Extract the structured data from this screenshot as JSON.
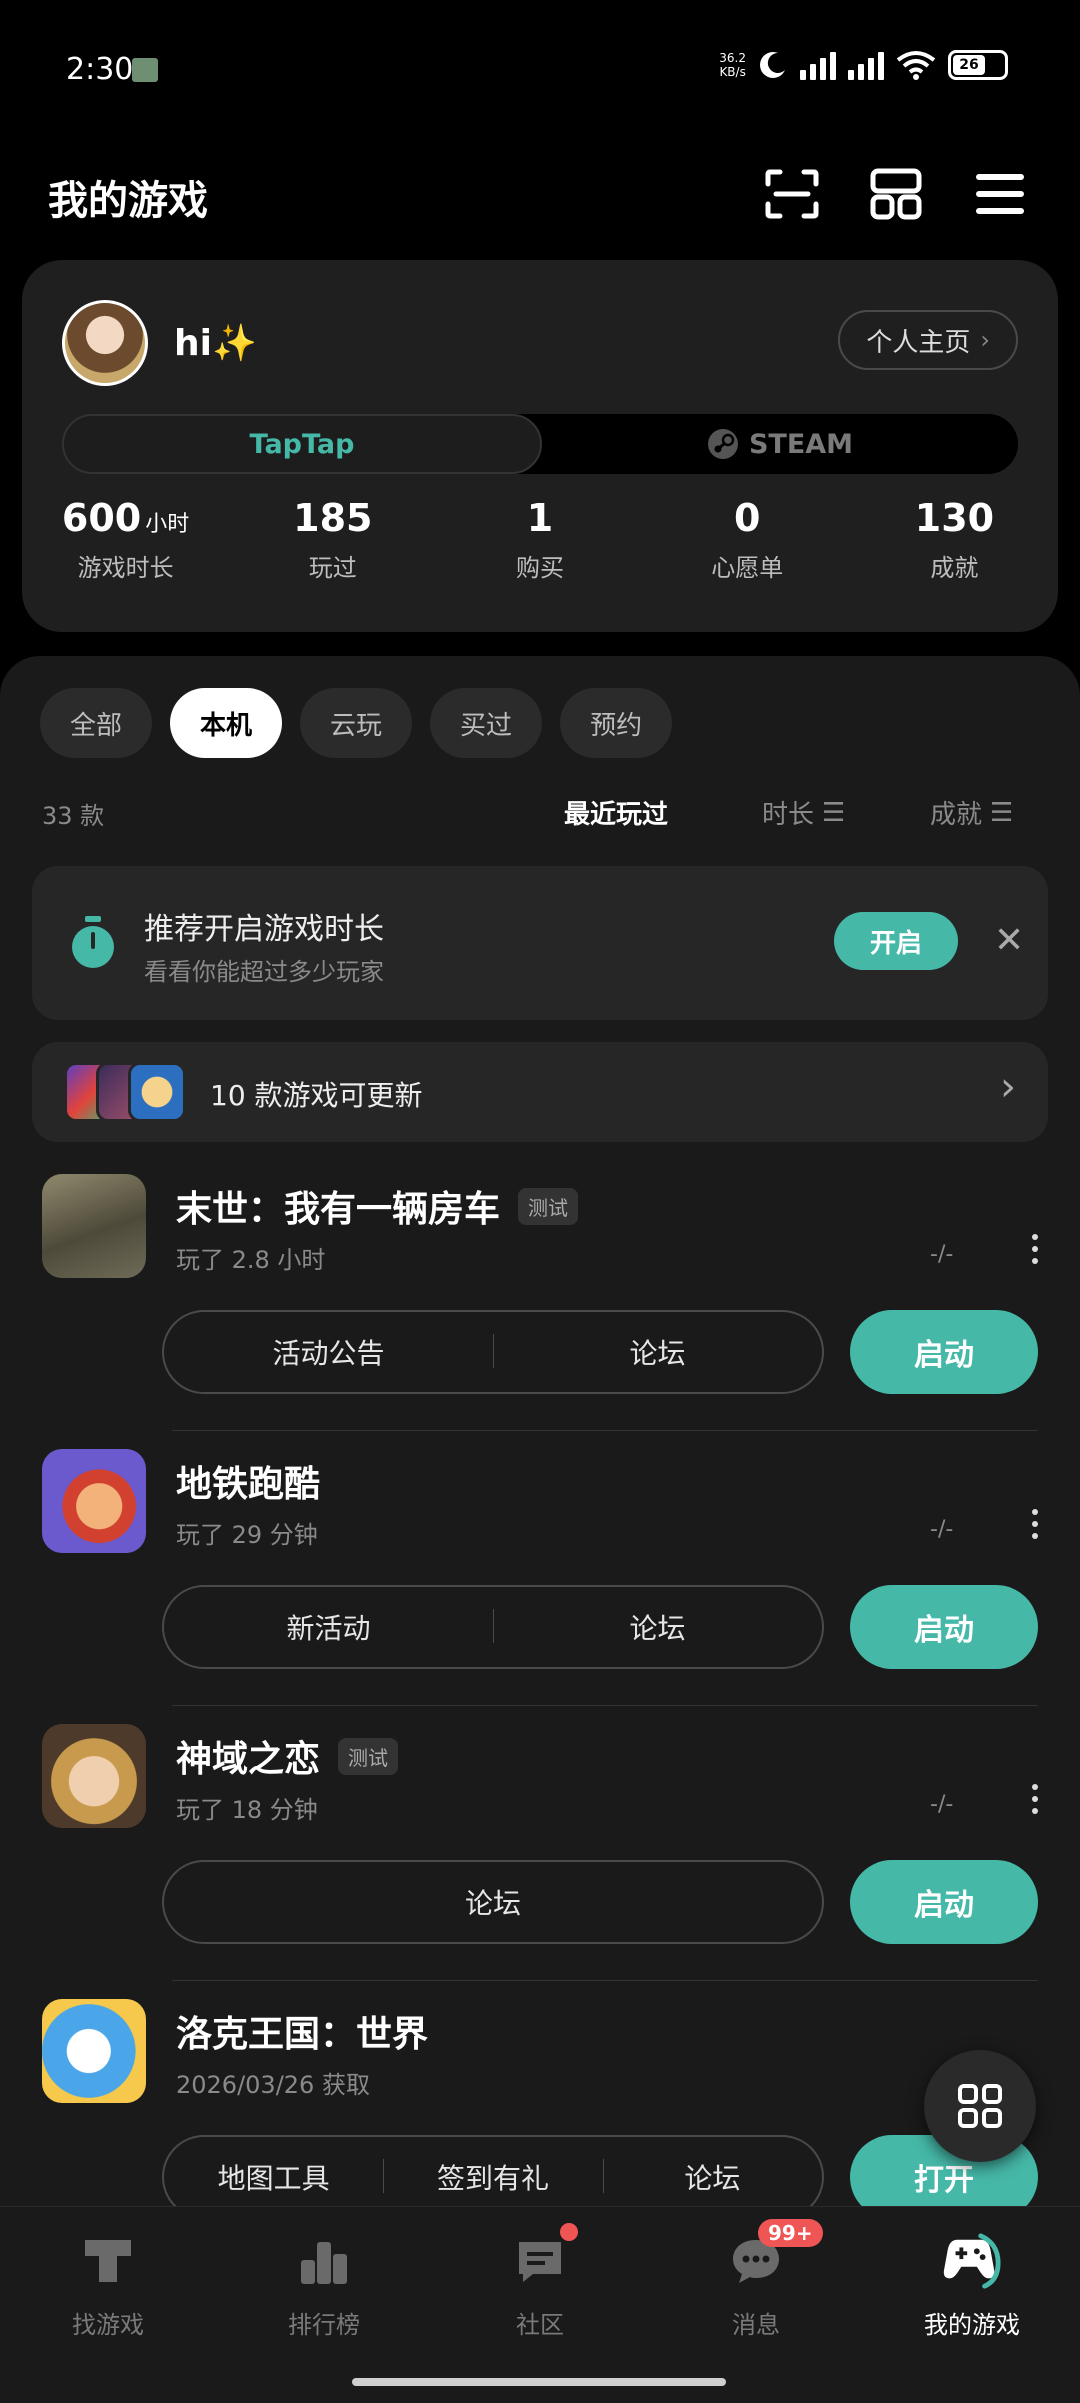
{
  "status": {
    "time": "2:30",
    "speed_top": "36.2",
    "speed_bottom": "KB/s",
    "battery": "26"
  },
  "header": {
    "title": "我的游戏",
    "scan_icon": "scan-icon",
    "layout_icon": "grid-layout-icon",
    "menu_icon": "hamburger-menu-icon"
  },
  "profile": {
    "name": "hi✨",
    "homepage_label": "个人主页",
    "platforms": [
      "TapTap",
      "STEAM"
    ],
    "stats": [
      {
        "value": "600",
        "unit": "小时",
        "label": "游戏时长"
      },
      {
        "value": "185",
        "unit": "",
        "label": "玩过"
      },
      {
        "value": "1",
        "unit": "",
        "label": "购买"
      },
      {
        "value": "0",
        "unit": "",
        "label": "心愿单"
      },
      {
        "value": "130",
        "unit": "",
        "label": "成就"
      }
    ]
  },
  "filters": {
    "chips": [
      "全部",
      "本机",
      "云玩",
      "买过",
      "预约"
    ],
    "active": "本机"
  },
  "list_meta": {
    "count": "33 款",
    "sort_recent": "最近玩过",
    "sort_duration": "时长",
    "sort_achievement": "成就"
  },
  "tip": {
    "title": "推荐开启游戏时长",
    "subtitle": "看看你能超过多少玩家",
    "button": "开启"
  },
  "update": {
    "text": "10 款游戏可更新"
  },
  "games": [
    {
      "title": "末世：我有一辆房车",
      "tag": "测试",
      "subtitle": "玩了 2.8 小时",
      "rating": "-/-",
      "links": [
        "活动公告",
        "论坛"
      ],
      "action": "启动",
      "icon_color": "#6c6a55"
    },
    {
      "title": "地铁跑酷",
      "tag": "",
      "subtitle": "玩了 29 分钟",
      "rating": "-/-",
      "links": [
        "新活动",
        "论坛"
      ],
      "action": "启动",
      "icon_color": "#c9483e"
    },
    {
      "title": "神域之恋",
      "tag": "测试",
      "subtitle": "玩了 18 分钟",
      "rating": "-/-",
      "links": [
        "论坛"
      ],
      "action": "启动",
      "icon_color": "#b58f5e"
    },
    {
      "title": "洛克王国：世界",
      "tag": "",
      "subtitle": "2026/03/26 获取",
      "rating": "",
      "links": [
        "地图工具",
        "签到有礼",
        "论坛"
      ],
      "action": "打开",
      "icon_color": "#4aa6e8"
    }
  ],
  "bottom_nav": {
    "items": [
      {
        "label": "找游戏",
        "icon": "taptap-logo-icon"
      },
      {
        "label": "排行榜",
        "icon": "ranking-icon"
      },
      {
        "label": "社区",
        "icon": "community-icon"
      },
      {
        "label": "消息",
        "icon": "message-icon",
        "badge": "99+"
      },
      {
        "label": "我的游戏",
        "icon": "my-games-icon"
      }
    ],
    "active": "我的游戏"
  },
  "colors": {
    "accent": "#46b8a8",
    "badge": "#f05555",
    "card": "#1f1f1f"
  }
}
